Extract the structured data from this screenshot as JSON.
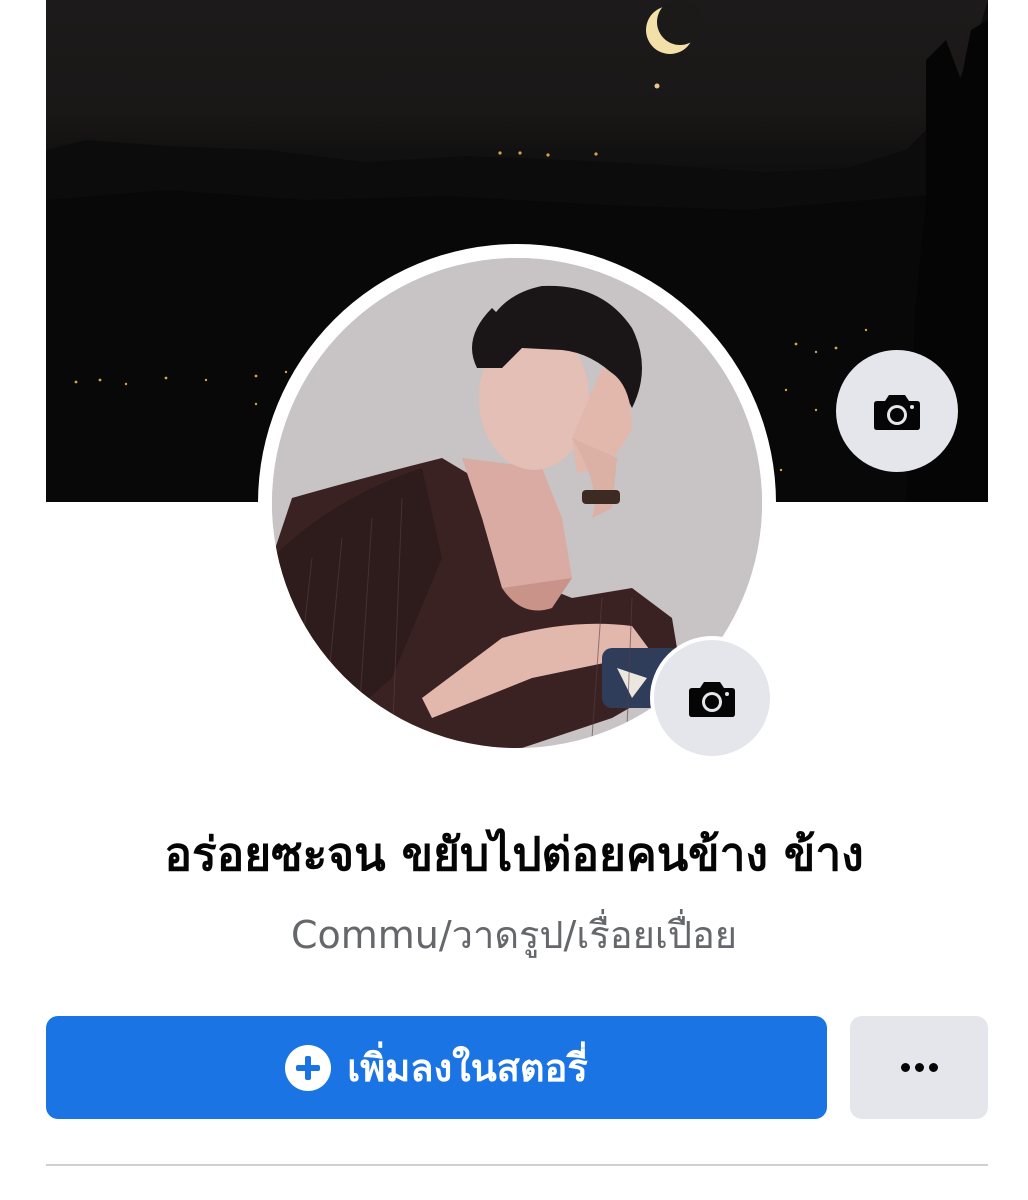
{
  "profile": {
    "name": "อร่อยซะจน ขยับไปต่อยคนข้าง ข้าง",
    "bio": "Commu/วาดรูป/เรื่อยเปื่อย"
  },
  "cover": {
    "image": "night-sky-crescent-moon-over-dark-hills",
    "camera_icon": "camera-icon"
  },
  "avatar": {
    "image": "illustrated-man-black-hair-dark-shirt",
    "camera_icon": "camera-icon"
  },
  "actions": {
    "add_story_label": "เพิ่มลงในสตอรี่",
    "add_story_icon": "plus-circle-icon",
    "more_icon": "more-dots-icon"
  },
  "colors": {
    "primary_button": "#1b74e4",
    "secondary_button": "#e4e6eb",
    "name_text": "#050505",
    "bio_text": "#65676b"
  }
}
